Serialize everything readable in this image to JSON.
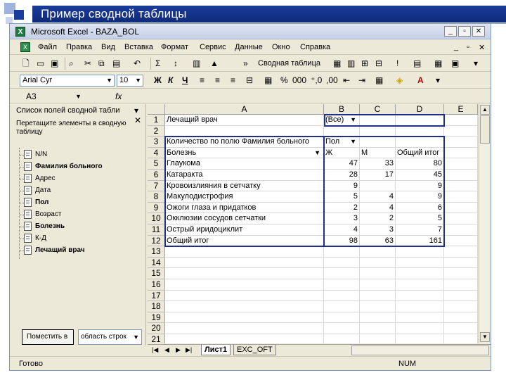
{
  "slide": {
    "title": "Пример сводной таблицы",
    "accent": "#1a3c9a"
  },
  "window": {
    "title": "Microsoft Excel - BAZA_BOL",
    "icon": "excel-icon"
  },
  "menu": [
    "Файл",
    "Правка",
    "Вид",
    "Вставка",
    "Формат",
    "Сервис",
    "Данные",
    "Окно",
    "Справка"
  ],
  "toolbar": {
    "font_name": "Arial Cyr",
    "font_size": "10",
    "pivot_table": "Сводная таблица"
  },
  "formula_bar": {
    "cell_ref": "A3",
    "fx": "fx",
    "content": ""
  },
  "field_list": {
    "title": "Список полей сводной табли",
    "hint": "Перетащите элементы в сводную таблицу",
    "fields": [
      {
        "name": "N/N",
        "bold": false
      },
      {
        "name": "Фамилия больного",
        "bold": true
      },
      {
        "name": "Адрес",
        "bold": false
      },
      {
        "name": "Дата",
        "bold": false
      },
      {
        "name": "Пол",
        "bold": true
      },
      {
        "name": "Возраст",
        "bold": false
      },
      {
        "name": "Болезнь",
        "bold": true
      },
      {
        "name": "К-Д",
        "bold": false
      },
      {
        "name": "Лечащий врач",
        "bold": true
      }
    ],
    "place_button": "Поместить в",
    "area_select": "область строк"
  },
  "sheet": {
    "columns": [
      "A",
      "B",
      "C",
      "D",
      "E"
    ],
    "rows": [
      "1",
      "2",
      "3",
      "4",
      "5",
      "6",
      "7",
      "8",
      "9",
      "10",
      "11",
      "12",
      "13",
      "14",
      "15",
      "16",
      "17",
      "18",
      "19",
      "20",
      "21"
    ],
    "page_field": {
      "label": "Лечащий врач",
      "value": "(Все)"
    },
    "data_header": "Количество по полю Фамилия больного",
    "col_field": "Пол",
    "row_field": "Болезнь",
    "col_items": [
      "Ж",
      "М",
      "Общий итог"
    ],
    "data_rows": [
      {
        "label": "Глаукома",
        "zh": "47",
        "m": "33",
        "total": "80"
      },
      {
        "label": "Катаракта",
        "zh": "28",
        "m": "17",
        "total": "45"
      },
      {
        "label": "Кровоизлияния в сетчатку",
        "zh": "9",
        "m": "",
        "total": "9"
      },
      {
        "label": "Макулодистрофия",
        "zh": "5",
        "m": "4",
        "total": "9"
      },
      {
        "label": "Ожоги глаза и придатков",
        "zh": "2",
        "m": "4",
        "total": "6"
      },
      {
        "label": "Окклюзии сосудов сетчатки",
        "zh": "3",
        "m": "2",
        "total": "5"
      },
      {
        "label": "Острый иридоциклит",
        "zh": "4",
        "m": "3",
        "total": "7"
      }
    ],
    "grand_total": {
      "label": "Общий итог",
      "zh": "98",
      "m": "63",
      "total": "161"
    }
  },
  "sheet_tabs": [
    "Лист1",
    "EXC_OFT"
  ],
  "status": {
    "text": "Готово",
    "num": "NUM"
  }
}
